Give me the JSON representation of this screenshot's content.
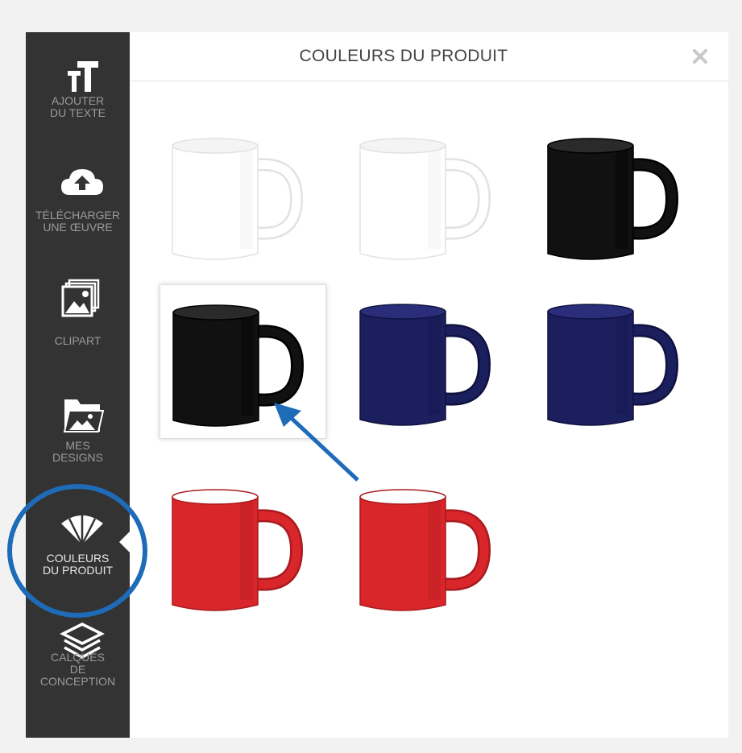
{
  "sidebar": {
    "items": [
      {
        "label": "AJOUTER\nDU TEXTE",
        "icon": "text-size-icon"
      },
      {
        "label": "TÉLÉCHARGER\nUNE ŒUVRE",
        "icon": "cloud-upload-icon"
      },
      {
        "label": "CLIPART",
        "icon": "image-stack-icon"
      },
      {
        "label": "MES\nDESIGNS",
        "icon": "image-folder-icon"
      },
      {
        "label": "COULEURS\nDU PRODUIT",
        "icon": "color-swatch-fan-icon",
        "active": true
      },
      {
        "label": "CALQUES\nDE\nCONCEPTION",
        "icon": "layers-icon"
      }
    ]
  },
  "panel": {
    "title": "COULEURS DU PRODUIT",
    "close_icon": "close-icon"
  },
  "colors": {
    "sidebar_bg": "#333333",
    "annotation_blue": "#1e6bb8",
    "mug_white": "#ffffff",
    "mug_black": "#111111",
    "mug_navy": "#1c1f5e",
    "mug_red": "#d9262b"
  },
  "mugs": [
    {
      "color": "white",
      "selected": false
    },
    {
      "color": "white",
      "selected": false
    },
    {
      "color": "black",
      "selected": false
    },
    {
      "color": "black",
      "selected": true
    },
    {
      "color": "navy",
      "selected": false
    },
    {
      "color": "navy",
      "selected": false
    },
    {
      "color": "red",
      "selected": false
    },
    {
      "color": "red",
      "selected": false
    }
  ]
}
